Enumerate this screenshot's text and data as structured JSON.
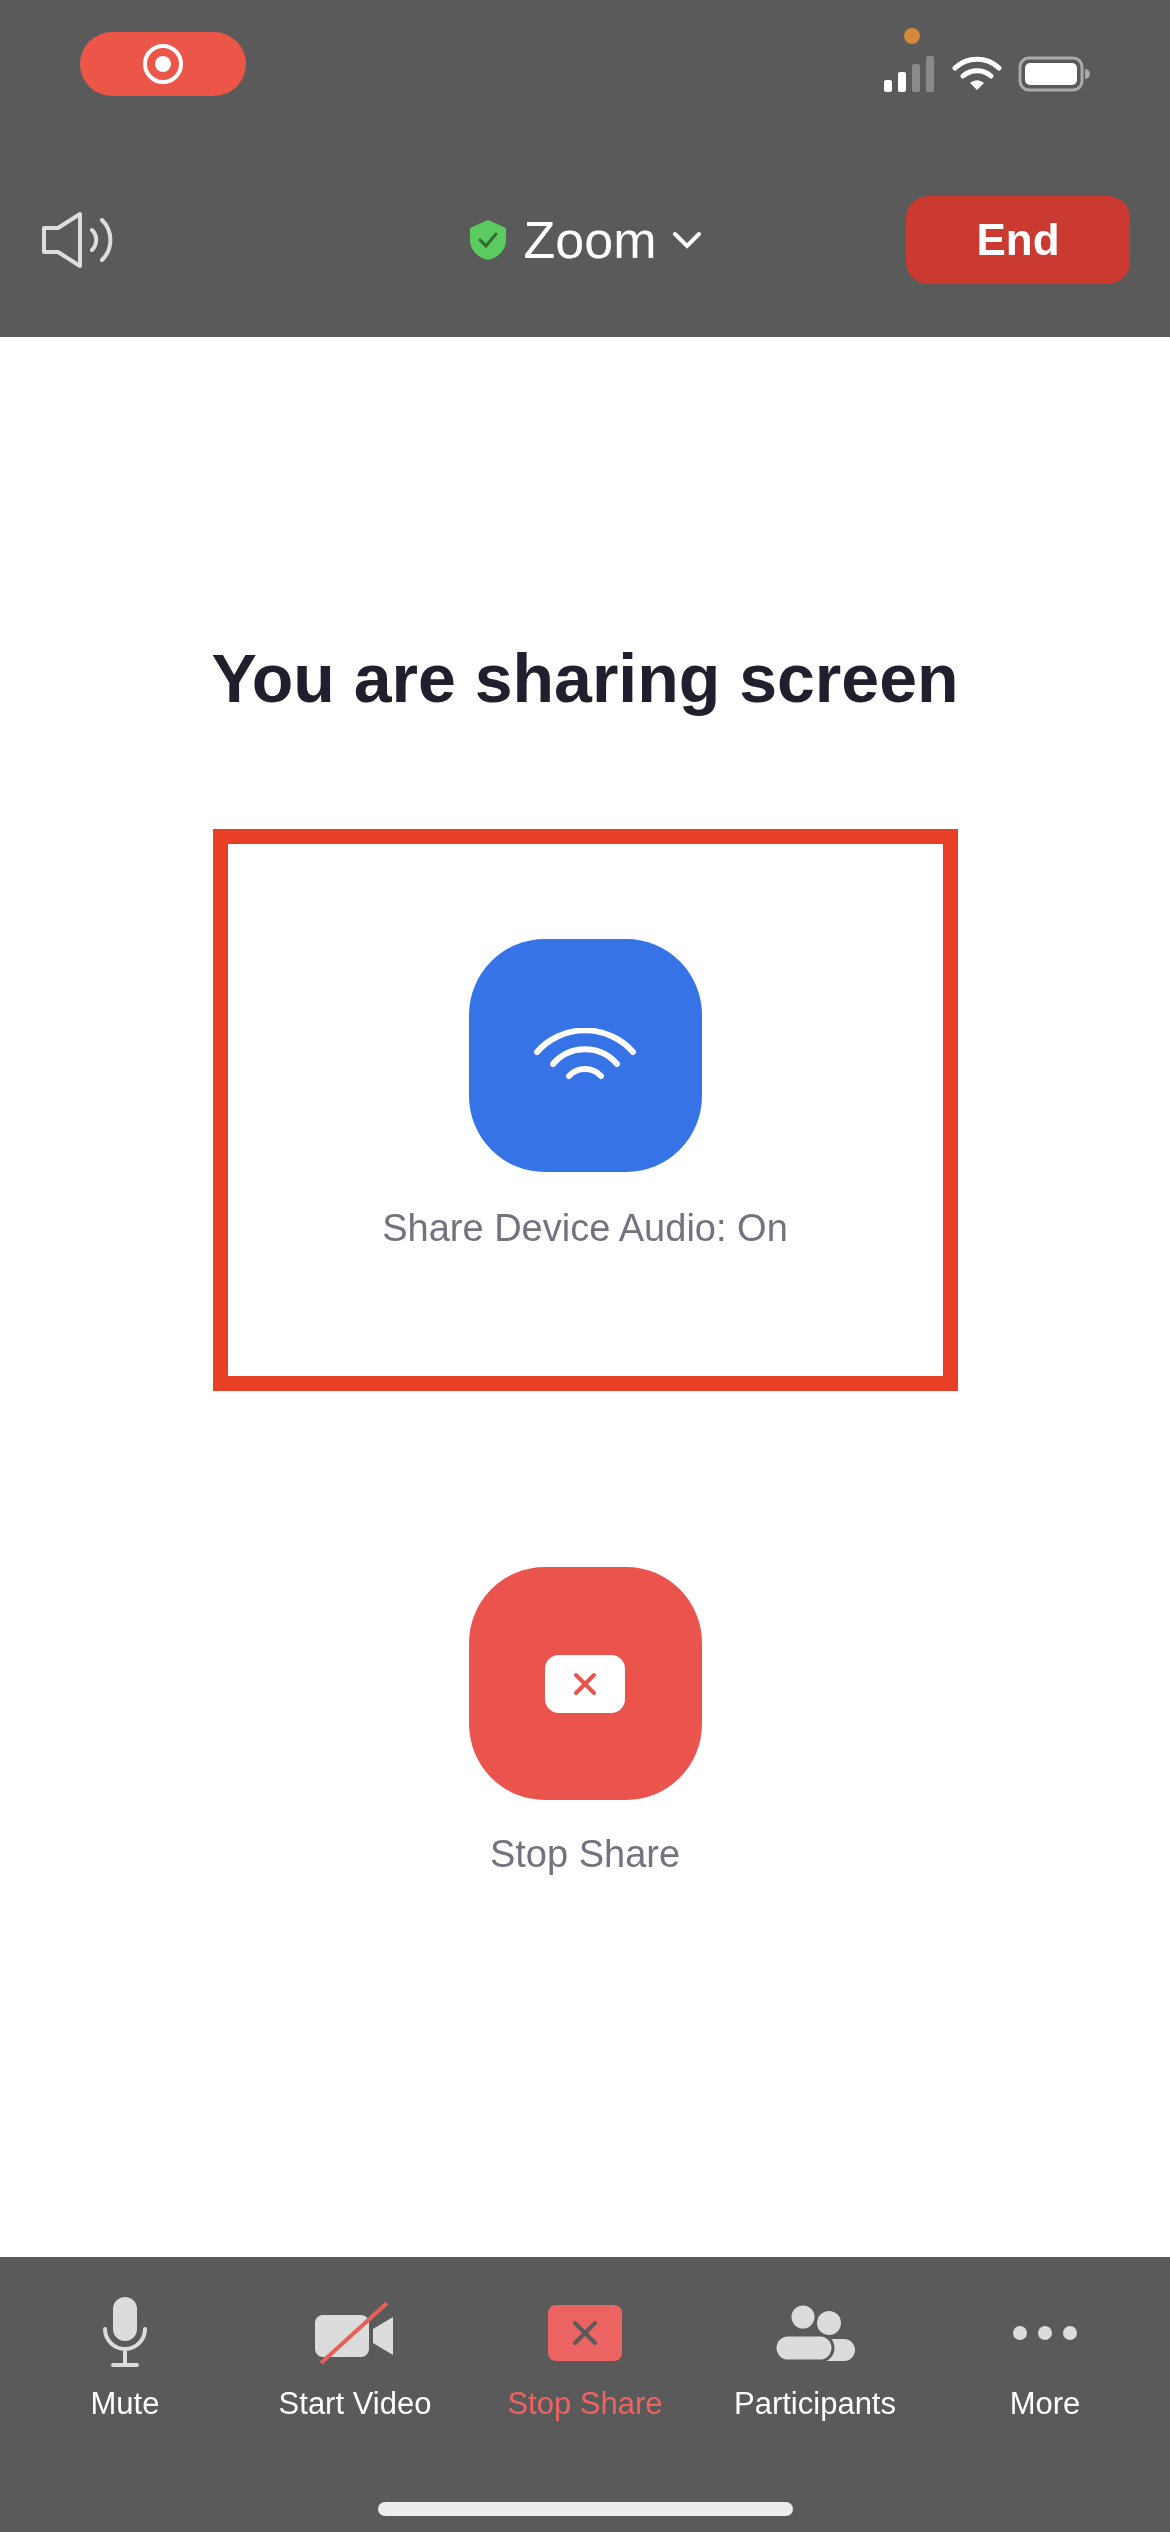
{
  "status_bar": {
    "recording": true
  },
  "header": {
    "title": "Zoom",
    "end_button": "End"
  },
  "main": {
    "heading": "You are sharing screen",
    "audio_button": {
      "label": "Share Device Audio: On",
      "on": true
    },
    "stop_button": {
      "label": "Stop Share"
    }
  },
  "toolbar": [
    {
      "kind": "mic",
      "label": "Mute",
      "highlighted": false
    },
    {
      "kind": "video-off",
      "label": "Start Video",
      "highlighted": false
    },
    {
      "kind": "stop-share",
      "label": "Stop Share",
      "highlighted": true
    },
    {
      "kind": "participants",
      "label": "Participants",
      "highlighted": false
    },
    {
      "kind": "more",
      "label": "More",
      "highlighted": false
    }
  ]
}
